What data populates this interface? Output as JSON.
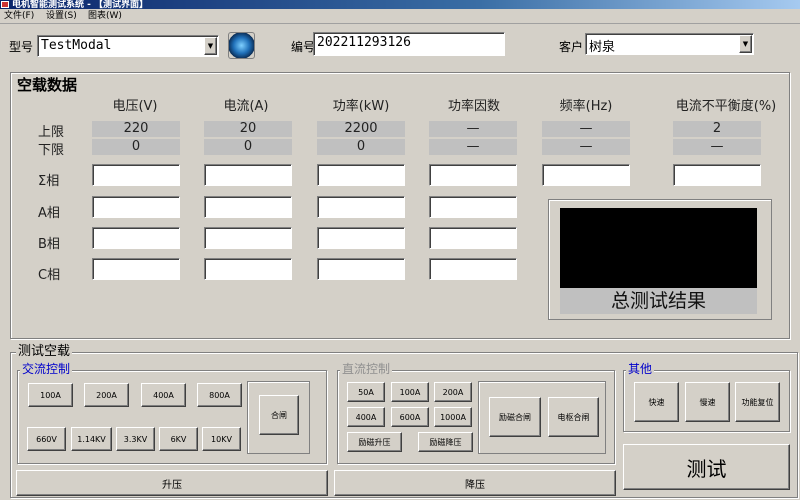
{
  "window": {
    "title": "电机智能测试系统 - 【测试界面】"
  },
  "menu": [
    "文件(F)",
    "设置(S)",
    "图表(W)"
  ],
  "top": {
    "model_label": "型号",
    "model_value": "TestModal",
    "serial_label": "编号",
    "serial_value": "202211293126",
    "customer_label": "客户",
    "customer_value": "树泉"
  },
  "noload": {
    "title": "空载数据",
    "headers": [
      "电压(V)",
      "电流(A)",
      "功率(kW)",
      "功率因数",
      "频率(Hz)",
      "电流不平衡度(%)"
    ],
    "upper_label": "上限",
    "lower_label": "下限",
    "upper": [
      "220",
      "20",
      "2200",
      "—",
      "—",
      "2"
    ],
    "lower": [
      "0",
      "0",
      "0",
      "—",
      "—",
      "—"
    ],
    "rows": [
      "Σ相",
      "A相",
      "B相",
      "C相"
    ],
    "result_label": "总测试结果"
  },
  "test_noload": {
    "title": "测试空载",
    "ac": {
      "title": "交流控制",
      "current_buttons": [
        "100A",
        "200A",
        "400A",
        "800A"
      ],
      "voltage_buttons": [
        "660V",
        "1.14KV",
        "3.3KV",
        "6KV",
        "10KV"
      ],
      "close_button": "合闸"
    },
    "dc": {
      "title": "直流控制",
      "row1": [
        "50A",
        "100A",
        "200A"
      ],
      "row2": [
        "400A",
        "600A",
        "1000A"
      ],
      "row3": [
        "励磁升压",
        "励磁降压"
      ],
      "excite_close": "励磁合闸",
      "armature_close": "电枢合闸"
    },
    "other": {
      "title": "其他",
      "buttons": [
        "快速",
        "慢速",
        "功能复位"
      ]
    },
    "raise_button": "升压",
    "lower_button": "降压",
    "test_button": "测试"
  }
}
